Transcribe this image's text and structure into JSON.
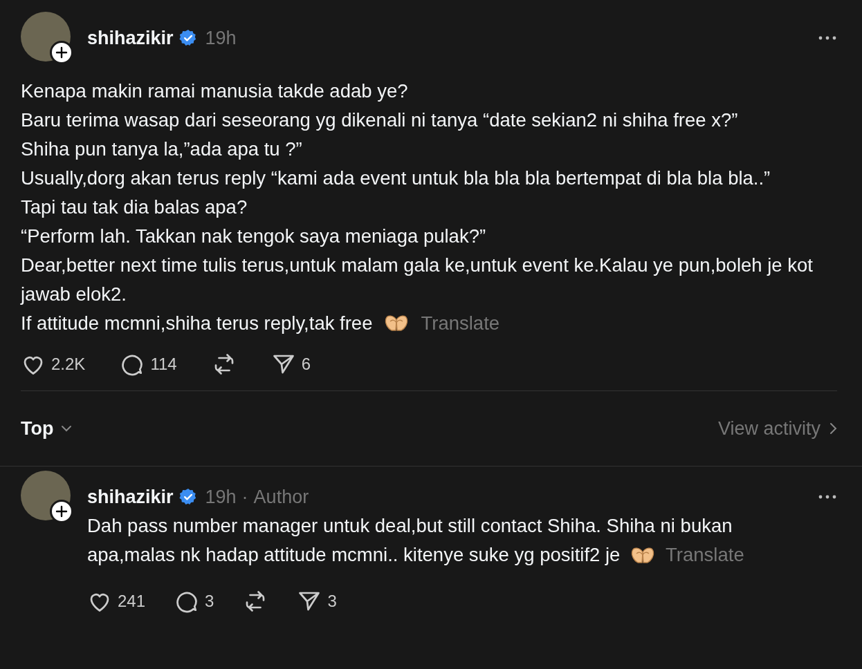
{
  "post": {
    "username": "shihazikir",
    "verified": true,
    "time": "19h",
    "lines": [
      "Kenapa makin ramai manusia takde adab ye?",
      "Baru terima wasap dari seseorang yg dikenali ni tanya “date sekian2 ni shiha free x?”",
      "Shiha pun tanya la,”ada apa tu ?”",
      "Usually,dorg akan terus reply “kami ada event untuk bla bla bla bertempat di bla bla bla..”",
      "Tapi tau tak dia balas apa?",
      "“Perform lah. Takkan nak tengok saya meniaga pulak?”",
      "Dear,better next time tulis terus,untuk malam gala ke,untuk event ke.Kalau ye pun,boleh je kot jawab elok2.",
      "If attitude mcmni,shiha terus reply,tak free"
    ],
    "translate": "Translate",
    "actions": [
      {
        "kind": "like",
        "count": "2.2K"
      },
      {
        "kind": "comment",
        "count": "114"
      },
      {
        "kind": "repost"
      },
      {
        "kind": "share",
        "count": "6"
      }
    ]
  },
  "sort": {
    "label": "Top",
    "view_activity": "View activity"
  },
  "reply": {
    "username": "shihazikir",
    "verified": true,
    "time": "19h",
    "separator": "·",
    "role": "Author",
    "text": "Dah pass number manager untuk deal,but still contact Shiha. Shiha ni bukan apa,malas nk hadap attitude mcmni.. kitenye suke yg positif2 je",
    "translate": "Translate",
    "actions": [
      {
        "kind": "like",
        "count": "241"
      },
      {
        "kind": "comment",
        "count": "3"
      },
      {
        "kind": "repost"
      },
      {
        "kind": "share",
        "count": "3"
      }
    ]
  }
}
